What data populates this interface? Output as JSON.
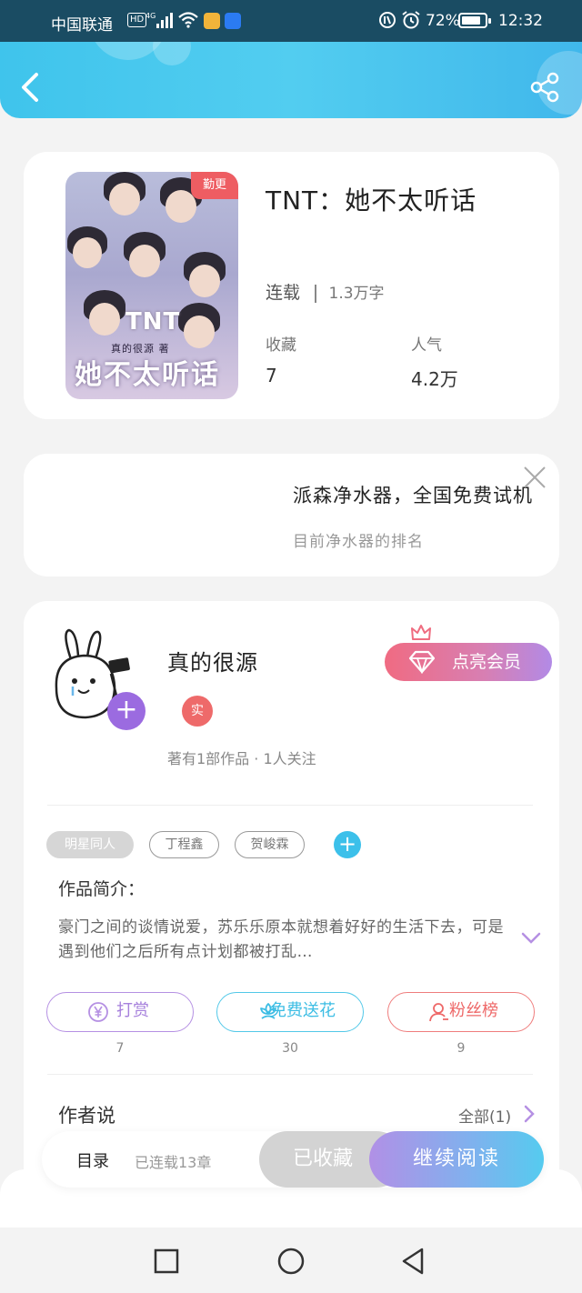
{
  "status_bar": {
    "carrier": "中国联通",
    "hd": "HD",
    "battery_pct": "72%",
    "time": "12:32"
  },
  "book": {
    "badge": "勤更",
    "cover_tnt": "TNT",
    "cover_subtitle": "真的很源 著",
    "cover_title": "她不太听话",
    "title": "TNT：她不太听话",
    "status": "连载",
    "word_count": "1.3万字",
    "favorites_label": "收藏",
    "favorites_value": "7",
    "popularity_label": "人气",
    "popularity_value": "4.2万"
  },
  "ad": {
    "title": "派森净水器，全国免费试机",
    "subtitle": "目前净水器的排名"
  },
  "author": {
    "name": "真的很源",
    "real_badge": "实",
    "meta": "著有1部作品 · 1人关注",
    "vip_label": "点亮会员"
  },
  "tags": [
    "明星同人",
    "丁程鑫",
    "贺峻霖"
  ],
  "intro": {
    "label": "作品简介：",
    "text": "豪门之间的谈情说爱，苏乐乐原本就想着好好的生活下去，可是遇到他们之后所有点计划都被打乱…"
  },
  "actions": [
    {
      "label": "打赏",
      "count": "7"
    },
    {
      "label": "免费送花",
      "count": "30"
    },
    {
      "label": "粉丝榜",
      "count": "9"
    }
  ],
  "author_says": {
    "label": "作者说",
    "all_label": "全部(1)"
  },
  "bottom_bar": {
    "toc_label": "目录",
    "toc_meta": "已连载13章",
    "fav_label": "已收藏",
    "read_label": "继续阅读"
  },
  "colors": {
    "header": "#4cc8ef",
    "accent_purple": "#9b6be0",
    "accent_red": "#ee5d62",
    "accent_cyan": "#3cc0ea"
  },
  "icons": [
    "back-icon",
    "share-icon",
    "close-icon",
    "plus-icon",
    "gem-icon",
    "crown-icon",
    "yen-icon",
    "flower-icon",
    "user-icon",
    "chevron-down-icon",
    "chevron-right-icon",
    "square-icon",
    "circle-icon",
    "triangle-icon"
  ]
}
